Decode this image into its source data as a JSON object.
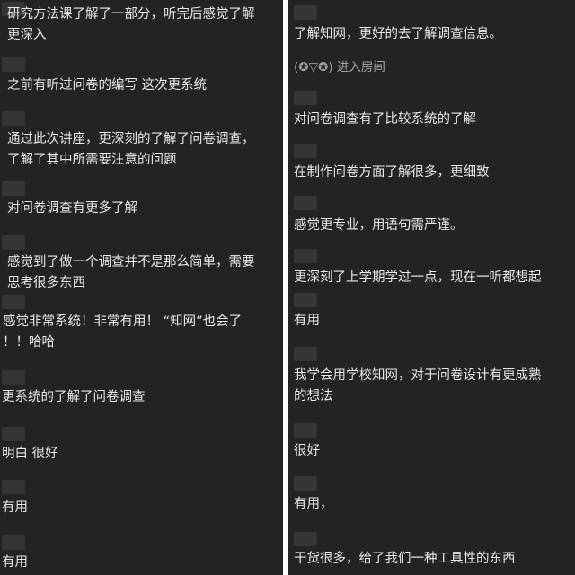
{
  "left_chat": {
    "messages": [
      {
        "text": [
          "研究方法课了解了一部分，听完后感觉了解",
          "更深入"
        ]
      },
      {
        "text": [
          "之前有听过问卷的编写  这次更系统"
        ]
      },
      {
        "text": [
          "通过此次讲座，更深刻的了解了问卷调查，",
          "了解了其中所需要注意的问题"
        ]
      },
      {
        "text": [
          "对问卷调查有更多了解"
        ]
      },
      {
        "text": [
          "感觉到了做一个调查并不是那么简单，需要",
          "思考很多东西"
        ]
      },
      {
        "text": [
          "感觉非常系统！非常有用！ “知网”也会了",
          "！！哈哈"
        ]
      },
      {
        "text": [
          "更系统的了解了问卷调查"
        ]
      },
      {
        "text": [
          "明白 很好"
        ]
      },
      {
        "text": [
          "有用"
        ]
      },
      {
        "text": [
          "有用"
        ]
      }
    ]
  },
  "right_chat": {
    "messages": [
      {
        "text": [
          "了解知网，更好的去了解调查信息。"
        ]
      },
      {
        "text": [
          "对问卷调查有了比较系统的了解"
        ]
      },
      {
        "text": [
          "在制作问卷方面了解很多，更细致"
        ]
      },
      {
        "text": [
          "感觉更专业，用语句需严谨。"
        ]
      },
      {
        "text": [
          "更深刻了上学期学过一点，现在一听都想起"
        ]
      },
      {
        "text": [
          "有用"
        ]
      },
      {
        "text": [
          "我学会用学校知网，对于问卷设计有更成熟",
          "的想法"
        ]
      },
      {
        "text": [
          "很好"
        ]
      },
      {
        "text": [
          "有用，"
        ]
      },
      {
        "text": [
          "干货很多，给了我们一种工具性的东西"
        ]
      }
    ],
    "system_note": "(✪▽✪) 进入房间"
  }
}
